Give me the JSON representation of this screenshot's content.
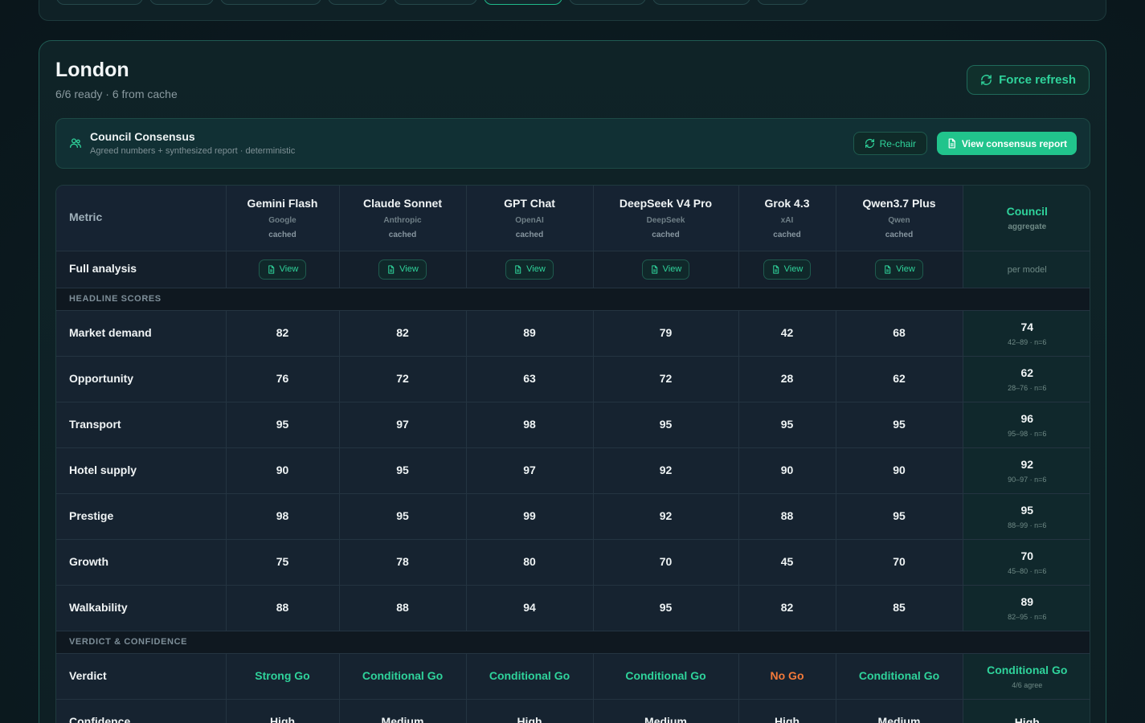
{
  "city": {
    "title": "London",
    "subtitle": "6/6 ready · 6 from cache",
    "force_refresh": "Force refresh"
  },
  "consensus": {
    "title": "Council Consensus",
    "subtitle": "Agreed numbers + synthesized report · deterministic",
    "rechair": "Re-chair",
    "view_report": "View consensus report"
  },
  "table": {
    "metric_header": "Metric",
    "models": [
      {
        "name": "Gemini Flash",
        "vendor": "Google",
        "status": "cached"
      },
      {
        "name": "Claude Sonnet",
        "vendor": "Anthropic",
        "status": "cached"
      },
      {
        "name": "GPT Chat",
        "vendor": "OpenAI",
        "status": "cached"
      },
      {
        "name": "DeepSeek V4 Pro",
        "vendor": "DeepSeek",
        "status": "cached"
      },
      {
        "name": "Grok 4.3",
        "vendor": "xAI",
        "status": "cached"
      },
      {
        "name": "Qwen3.7 Plus",
        "vendor": "Qwen",
        "status": "cached"
      }
    ],
    "council": {
      "name": "Council",
      "sub": "aggregate"
    },
    "full_analysis": {
      "label": "Full analysis",
      "view": "View",
      "council_text": "per model"
    },
    "sections": {
      "headline": "HEADLINE SCORES",
      "verdict": "VERDICT & CONFIDENCE"
    },
    "scores": [
      {
        "label": "Market demand",
        "values": [
          "82",
          "82",
          "89",
          "79",
          "42",
          "68"
        ],
        "agg": "74",
        "agg_sub": "42–89 · n=6"
      },
      {
        "label": "Opportunity",
        "values": [
          "76",
          "72",
          "63",
          "72",
          "28",
          "62"
        ],
        "agg": "62",
        "agg_sub": "28–76 · n=6"
      },
      {
        "label": "Transport",
        "values": [
          "95",
          "97",
          "98",
          "95",
          "95",
          "95"
        ],
        "agg": "96",
        "agg_sub": "95–98 · n=6"
      },
      {
        "label": "Hotel supply",
        "values": [
          "90",
          "95",
          "97",
          "92",
          "90",
          "90"
        ],
        "agg": "92",
        "agg_sub": "90–97 · n=6"
      },
      {
        "label": "Prestige",
        "values": [
          "98",
          "95",
          "99",
          "92",
          "88",
          "95"
        ],
        "agg": "95",
        "agg_sub": "88–99 · n=6"
      },
      {
        "label": "Growth",
        "values": [
          "75",
          "78",
          "80",
          "70",
          "45",
          "70"
        ],
        "agg": "70",
        "agg_sub": "45–80 · n=6"
      },
      {
        "label": "Walkability",
        "values": [
          "88",
          "88",
          "94",
          "95",
          "82",
          "85"
        ],
        "agg": "89",
        "agg_sub": "82–95 · n=6"
      }
    ],
    "verdict": {
      "label": "Verdict",
      "values": [
        "Strong Go",
        "Conditional Go",
        "Conditional Go",
        "Conditional Go",
        "No Go",
        "Conditional Go"
      ],
      "agg": "Conditional Go",
      "agg_sub": "4/6 agree"
    },
    "confidence": {
      "label": "Confidence",
      "values": [
        "High",
        "Medium",
        "High",
        "Medium",
        "High",
        "Medium"
      ],
      "agg": "High"
    }
  },
  "colors": {
    "accent": "#2fd39b",
    "nogo": "#f47a3a"
  },
  "icons": {
    "refresh": "refresh-icon",
    "users": "users-icon",
    "document": "document-icon"
  }
}
